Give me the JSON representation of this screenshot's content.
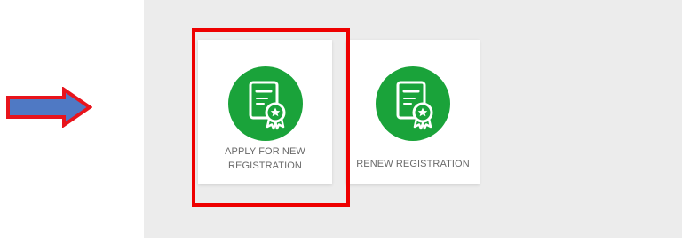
{
  "cards": [
    {
      "id": "apply",
      "label_line1": "APPLY FOR NEW",
      "label_line2": "REGISTRATION",
      "icon": "certificate-icon"
    },
    {
      "id": "renew",
      "label_line1": "RENEW REGISTRATION",
      "icon": "certificate-icon"
    }
  ],
  "colors": {
    "icon_circle": "#1aa33a",
    "highlight": "#ee0000",
    "arrow_fill": "#4f79c4",
    "arrow_stroke": "#e8141c",
    "content_bg": "#ececec"
  },
  "annotations": {
    "arrow": "right-arrow-icon",
    "highlight": "highlight-box"
  }
}
